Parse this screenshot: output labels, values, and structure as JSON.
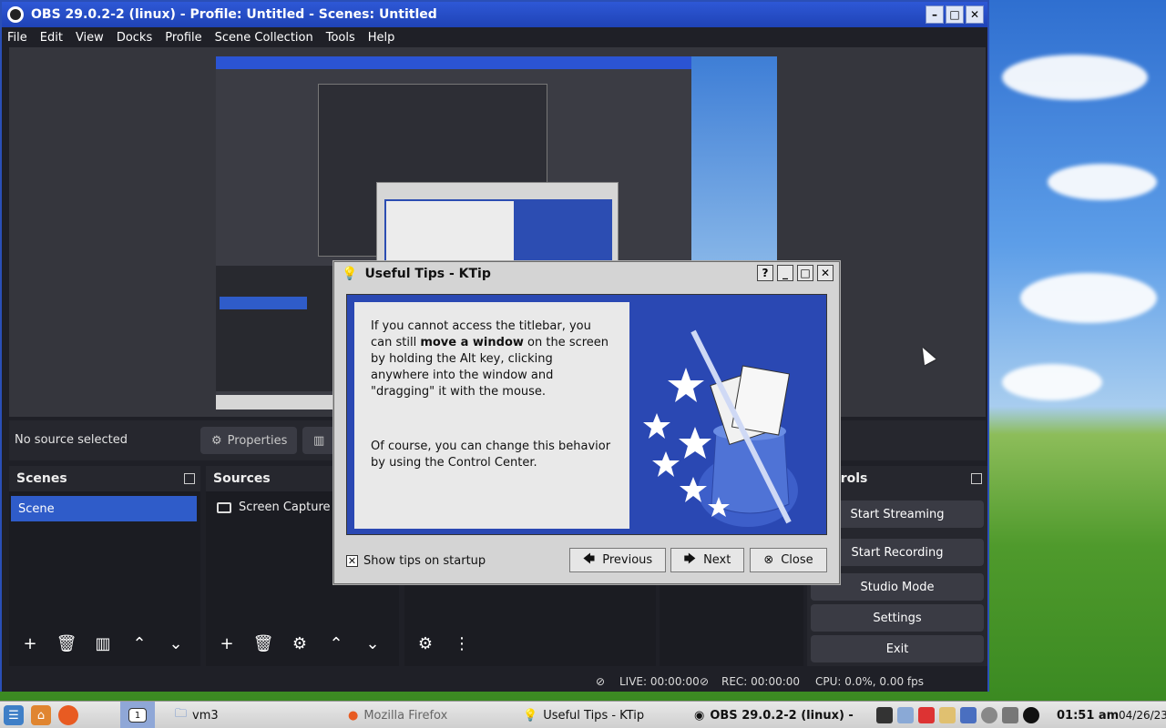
{
  "obs": {
    "title": "OBS 29.0.2-2 (linux) - Profile: Untitled - Scenes: Untitled",
    "menu": [
      "File",
      "Edit",
      "View",
      "Docks",
      "Profile",
      "Scene Collection",
      "Tools",
      "Help"
    ],
    "source_bar": {
      "no_source": "No source selected",
      "properties": "Properties"
    },
    "scenes": {
      "header": "Scenes",
      "items": [
        "Scene"
      ]
    },
    "sources": {
      "header": "Sources",
      "items": [
        "Screen Capture (X"
      ]
    },
    "controls": {
      "header_partial": "trols",
      "buttons": [
        "Start Streaming",
        "Start Recording",
        "Studio Mode",
        "Settings",
        "Exit"
      ]
    },
    "status": {
      "live": "LIVE: 00:00:00",
      "rec": "REC: 00:00:00",
      "cpu": "CPU: 0.0%, 0.00 fps"
    }
  },
  "tips": {
    "title": "Useful Tips - KTip",
    "text_pre": "If you cannot access the titlebar, you can still ",
    "text_bold": "move a window",
    "text_post": " on the screen by holding the Alt key, clicking anywhere into the window and \"dragging\" it with the mouse.",
    "text_2": "Of course, you can change this behavior by using the Control Center.",
    "show_on_startup": "Show tips on startup",
    "show_on_startup_checked": true,
    "previous": "Previous",
    "next": "Next",
    "close": "Close"
  },
  "taskbar": {
    "tasks": [
      "vm3",
      "Mozilla Firefox",
      "Useful Tips - KTip",
      "OBS 29.0.2-2 (linux) -"
    ],
    "time": "01:51 am",
    "date": "04/26/23"
  }
}
